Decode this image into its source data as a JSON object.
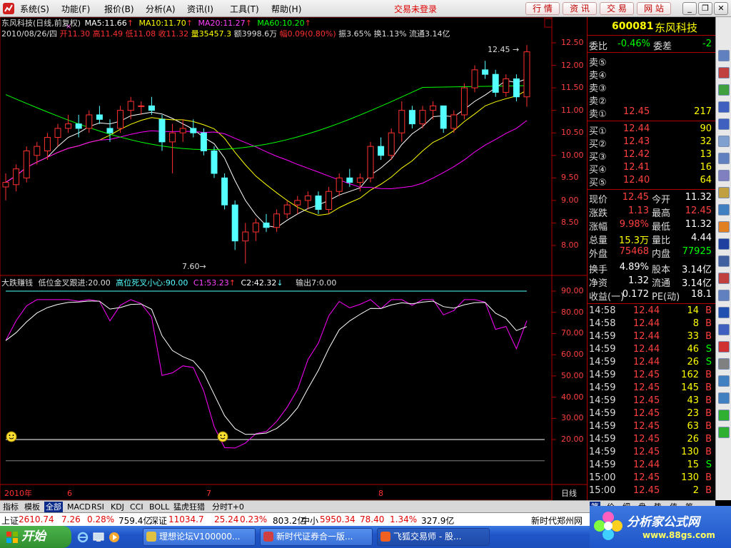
{
  "menu": {
    "items": [
      "系统(S)",
      "功能(F)",
      "报价(B)",
      "分析(A)",
      "资讯(I)",
      "工具(T)",
      "帮助(H)"
    ],
    "status": "交易未登录",
    "buttons": [
      "行 情",
      "资 讯",
      "交 易",
      "网 站"
    ]
  },
  "stock": {
    "code": "600081",
    "name": "东风科技"
  },
  "chart": {
    "header1_name": "东风科技(日线,前复权)",
    "ma5": "MA5:11.66",
    "ma10": "MA10:11.70",
    "ma20": "MA20:11.27",
    "ma60": "MA60:10.20",
    "header2_date": "2010/08/26/四",
    "open": "开11.30",
    "high": "高11.49",
    "low": "低11.08",
    "close": "收11.32",
    "vol": "量35457.3",
    "amt": "额3998.6万",
    "chg": "幅0.09(0.80%)",
    "amp": "振3.65%",
    "turn": "换1.13%",
    "float": "流通3.14亿",
    "high_label": "12.45",
    "low_label": "7.60",
    "price_ticks": [
      "12.50",
      "12.00",
      "11.50",
      "11.00",
      "10.50",
      "10.00",
      "9.50",
      "9.00",
      "8.50",
      "8.00"
    ],
    "ind_name": "大跌赚钱",
    "ind_low": "低位金叉跟进:20.00",
    "ind_high": "高位死叉小心:90.00",
    "ind_c1": "C1:53.23",
    "ind_c2": "C2:42.32",
    "ind_out": "输出7:0.00",
    "ind_ticks": [
      "90.00",
      "80.00",
      "70.00",
      "60.00",
      "50.00",
      "40.00",
      "30.00",
      "20.00"
    ],
    "date_labels": [
      "2010年",
      "6",
      "7",
      "8"
    ],
    "period": "日线",
    "colors": {
      "up": "#ff3030",
      "down": "#54ffff",
      "ma5": "#ffffff",
      "ma10": "#ffff00",
      "ma20": "#ff00ff",
      "ma60": "#00ff00"
    }
  },
  "chart_data": {
    "type": "candlestick",
    "title": "东风科技(日线,前复权)",
    "ylim": [
      7.6,
      12.45
    ],
    "candles": [
      [
        9.3,
        9.6,
        9.0,
        9.4
      ],
      [
        9.35,
        9.8,
        9.2,
        9.7
      ],
      [
        9.5,
        10.2,
        9.4,
        10.1
      ],
      [
        10.0,
        10.3,
        9.8,
        10.2
      ],
      [
        10.1,
        10.5,
        9.9,
        10.4
      ],
      [
        10.4,
        10.7,
        10.2,
        10.6
      ],
      [
        10.6,
        10.9,
        10.5,
        10.7
      ],
      [
        10.7,
        10.9,
        10.4,
        10.6
      ],
      [
        10.6,
        11.0,
        10.5,
        10.9
      ],
      [
        10.9,
        11.1,
        10.7,
        10.8
      ],
      [
        10.6,
        10.8,
        10.3,
        10.5
      ],
      [
        10.6,
        11.1,
        10.5,
        11.0
      ],
      [
        11.0,
        11.3,
        10.8,
        11.2
      ],
      [
        11.1,
        11.2,
        10.9,
        11.1
      ],
      [
        11.1,
        11.3,
        10.9,
        11.0
      ],
      [
        10.8,
        10.9,
        10.1,
        10.3
      ],
      [
        10.3,
        10.7,
        9.6,
        10.5
      ],
      [
        10.5,
        10.8,
        10.3,
        10.6
      ],
      [
        10.6,
        10.8,
        10.4,
        10.5
      ],
      [
        10.5,
        10.6,
        10.0,
        10.1
      ],
      [
        10.1,
        10.2,
        9.5,
        9.6
      ],
      [
        9.5,
        9.6,
        8.8,
        8.9
      ],
      [
        8.9,
        9.0,
        7.9,
        8.1
      ],
      [
        8.1,
        8.5,
        7.6,
        8.3
      ],
      [
        8.3,
        8.6,
        8.1,
        8.5
      ],
      [
        8.5,
        8.7,
        8.3,
        8.4
      ],
      [
        8.4,
        8.8,
        8.3,
        8.7
      ],
      [
        8.7,
        9.0,
        8.6,
        8.9
      ],
      [
        8.9,
        9.1,
        8.7,
        9.0
      ],
      [
        9.0,
        9.2,
        8.8,
        9.1
      ],
      [
        9.1,
        9.2,
        8.7,
        8.8
      ],
      [
        8.8,
        9.3,
        8.7,
        9.2
      ],
      [
        9.2,
        9.6,
        9.1,
        9.5
      ],
      [
        9.5,
        9.7,
        9.3,
        9.4
      ],
      [
        9.4,
        9.6,
        9.2,
        9.5
      ],
      [
        9.5,
        10.3,
        9.4,
        10.2
      ],
      [
        10.2,
        10.4,
        9.9,
        10.0
      ],
      [
        10.0,
        10.6,
        9.9,
        10.5
      ],
      [
        10.5,
        11.2,
        10.3,
        11.0
      ],
      [
        11.0,
        11.1,
        10.6,
        10.7
      ],
      [
        10.7,
        11.1,
        10.6,
        11.0
      ],
      [
        11.0,
        11.2,
        10.8,
        11.1
      ],
      [
        11.1,
        11.1,
        10.5,
        10.6
      ],
      [
        10.6,
        11.0,
        10.5,
        10.9
      ],
      [
        10.9,
        11.6,
        10.8,
        11.5
      ],
      [
        11.5,
        12.0,
        11.4,
        11.9
      ],
      [
        11.9,
        12.1,
        11.7,
        11.8
      ],
      [
        11.8,
        11.9,
        11.3,
        11.4
      ],
      [
        11.4,
        11.8,
        11.3,
        11.7
      ],
      [
        11.7,
        11.8,
        11.2,
        11.3
      ],
      [
        11.3,
        12.45,
        11.08,
        12.3
      ]
    ],
    "ind_range": [
      10,
      90
    ],
    "ind_levels": [
      20,
      90
    ]
  },
  "panel": {
    "webi_label": "委比",
    "webi_val": "-0.46%",
    "wecha_label": "委差",
    "wecha_val": "-2",
    "sell": [
      {
        "l": "卖⑤",
        "p": "",
        "v": ""
      },
      {
        "l": "卖④",
        "p": "",
        "v": ""
      },
      {
        "l": "卖③",
        "p": "",
        "v": ""
      },
      {
        "l": "卖②",
        "p": "",
        "v": ""
      },
      {
        "l": "卖①",
        "p": "12.45",
        "v": "217"
      }
    ],
    "buy": [
      {
        "l": "买①",
        "p": "12.44",
        "v": "90"
      },
      {
        "l": "买②",
        "p": "12.43",
        "v": "32"
      },
      {
        "l": "买③",
        "p": "12.42",
        "v": "13"
      },
      {
        "l": "买④",
        "p": "12.41",
        "v": "16"
      },
      {
        "l": "买⑤",
        "p": "12.40",
        "v": "64"
      }
    ],
    "stats": [
      {
        "a": "现价",
        "av": "12.45",
        "b": "今开",
        "bv": "11.32",
        "ac": "#ff4040",
        "bc": "#fff"
      },
      {
        "a": "涨跌",
        "av": "1.13",
        "b": "最高",
        "bv": "12.45",
        "ac": "#ff4040",
        "bc": "#ff4040"
      },
      {
        "a": "涨幅",
        "av": "9.98%",
        "b": "最低",
        "bv": "11.32",
        "ac": "#ff4040",
        "bc": "#fff"
      },
      {
        "a": "总量",
        "av": "15.3万",
        "b": "量比",
        "bv": "4.44",
        "ac": "#ffff00",
        "bc": "#fff"
      },
      {
        "a": "外盘",
        "av": "75468",
        "b": "内盘",
        "bv": "77925",
        "ac": "#ff4040",
        "bc": "#00ff00"
      },
      {
        "a": "换手",
        "av": "4.89%",
        "b": "股本",
        "bv": "3.14亿",
        "ac": "#fff",
        "bc": "#fff"
      },
      {
        "a": "净资",
        "av": "1.32",
        "b": "流通",
        "bv": "3.14亿",
        "ac": "#fff",
        "bc": "#fff"
      },
      {
        "a": "收益(一)",
        "av": "0.172",
        "b": "PE(动)",
        "bv": "18.1",
        "ac": "#fff",
        "bc": "#fff"
      }
    ],
    "ticks": [
      [
        "14:58",
        "12.44",
        "14",
        "B"
      ],
      [
        "14:58",
        "12.44",
        "8",
        "B"
      ],
      [
        "14:59",
        "12.44",
        "33",
        "B"
      ],
      [
        "14:59",
        "12.44",
        "46",
        "S"
      ],
      [
        "14:59",
        "12.44",
        "26",
        "S"
      ],
      [
        "14:59",
        "12.45",
        "162",
        "B"
      ],
      [
        "14:59",
        "12.45",
        "145",
        "B"
      ],
      [
        "14:59",
        "12.45",
        "43",
        "B"
      ],
      [
        "14:59",
        "12.45",
        "23",
        "B"
      ],
      [
        "14:59",
        "12.45",
        "63",
        "B"
      ],
      [
        "14:59",
        "12.45",
        "26",
        "B"
      ],
      [
        "14:59",
        "12.45",
        "130",
        "B"
      ],
      [
        "14:59",
        "12.44",
        "15",
        "S"
      ],
      [
        "15:00",
        "12.45",
        "130",
        "B"
      ],
      [
        "15:00",
        "12.45",
        "2",
        "B"
      ]
    ],
    "tabs": [
      "笔",
      "价",
      "细",
      "盘",
      "势",
      "值",
      "筹"
    ]
  },
  "tabs": [
    "指标",
    "模板",
    "全部",
    "MACD",
    "RSI",
    "KDJ",
    "CCI",
    "BOLL",
    "猛虎狂猎",
    "分时T+0"
  ],
  "indexbar": {
    "sh_l": "上证",
    "sh_v": "2610.74",
    "sh_c": "7.26",
    "sh_p": "0.28%",
    "sh_a": "759.4亿",
    "sz_l": "深证",
    "sz_v": "11034.7",
    "sz_c": "25.24",
    "sz_p": "0.23%",
    "sz_a": "803.2亿",
    "zx_l": "中小",
    "zx_v": "5950.34",
    "zx_c": "78.40",
    "zx_p": "1.34%",
    "zx_a": "327.9亿",
    "news": "新时代郑州网"
  },
  "taskbar": {
    "start": "开始",
    "tasks": [
      "理想论坛V100000...",
      "新时代证券合一版...",
      "飞狐交易师 - 股..."
    ]
  },
  "watermark": {
    "title": "分析家公式网",
    "url": "www.88gs.com"
  }
}
